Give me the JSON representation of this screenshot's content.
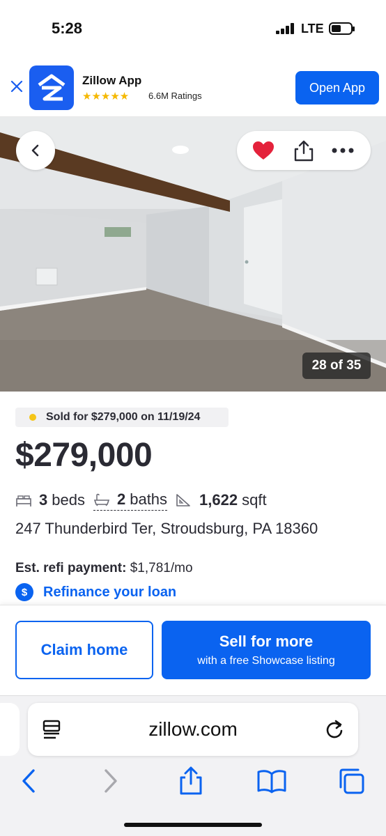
{
  "status_bar": {
    "time": "5:28",
    "network": "LTE",
    "icons": [
      "signal-icon",
      "battery-icon"
    ]
  },
  "app_banner": {
    "app_name": "Zillow App",
    "stars": "★★★★★",
    "ratings": "6.6M Ratings",
    "open_label": "Open App",
    "icons": [
      "close-icon",
      "zillow-logo"
    ]
  },
  "photo": {
    "counter": "28 of 35",
    "icons": [
      "back-icon",
      "heart-icon",
      "share-icon",
      "more-icon"
    ]
  },
  "listing": {
    "sold_text": "Sold for $279,000 on 11/19/24",
    "price": "$279,000",
    "beds_value": "3",
    "beds_label": "beds",
    "baths_value": "2",
    "baths_label": "baths",
    "sqft_value": "1,622",
    "sqft_label": "sqft",
    "address": "247 Thunderbird Ter, Stroudsburg, PA 18360",
    "refi_label": "Est. refi payment:",
    "refi_value": "$1,781/mo",
    "refi_link": "Refinance your loan"
  },
  "actions": {
    "claim_label": "Claim home",
    "sell_title": "Sell for more",
    "sell_subtitle": "with a free Showcase listing"
  },
  "browser": {
    "url": "zillow.com",
    "icons": [
      "reader-icon",
      "reload-icon",
      "back-arrow-icon",
      "forward-arrow-icon",
      "share-icon",
      "bookmarks-icon",
      "tabs-icon"
    ]
  },
  "colors": {
    "brand_blue": "#0a63f0",
    "heart_red": "#e4223b",
    "sold_dot": "#f5c518",
    "star": "#f5b800"
  }
}
